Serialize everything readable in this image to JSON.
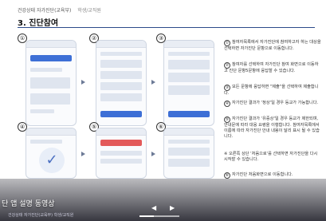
{
  "header": {
    "breadcrumb": "건강상태 자가진단(교육부)",
    "breadcrumb_sub": "학생/교직원",
    "title": "3. 진단참여"
  },
  "steps": [
    {
      "num": "①",
      "text": "참여자목록에서 자가진단에 참여하고자 하는 대상을 선택하면 자가진단 문항으로 이동합니다."
    },
    {
      "num": "②",
      "text": "참여자를 선택하여 자가진단 참여 화면으로 이동하고 진단 문항5문항에 응답할 수 있습니다."
    },
    {
      "num": "③",
      "text": "모든 문항에 응답하면 \"제출\"을 선택하여 제출합니다."
    },
    {
      "num": "④",
      "text": "자가진단 결과가 '정상'일 경우 등교가 가능합니다."
    },
    {
      "num": "⑤",
      "text": "자가진단 결과가 '유증상'일 경우 등교가 제한되며, 안내문에 따라 대응 요령을 이행합니다. 참여자목록에서 이름에 따라 자가진단 안내 내용이 달리 표시 될 수 있습니다."
    },
    {
      "num": "※",
      "text": "오른쪽 상단 '처음으로'를 선택하면 자가진단을 다시 시작할 수 있습니다."
    },
    {
      "num": "⑥",
      "text": "자가진단 처음화면으로 이동합니다."
    }
  ],
  "screens": [
    "①",
    "②",
    "③",
    "④",
    "⑤",
    "⑥"
  ],
  "video": {
    "title": "단 앱 설명 동영상",
    "bottom_text": "건강상태 자가진단(교육부) 학생/교직원",
    "progress": 0.35
  },
  "icons": {
    "check": "✓",
    "prev": "◀",
    "next": "▶"
  }
}
